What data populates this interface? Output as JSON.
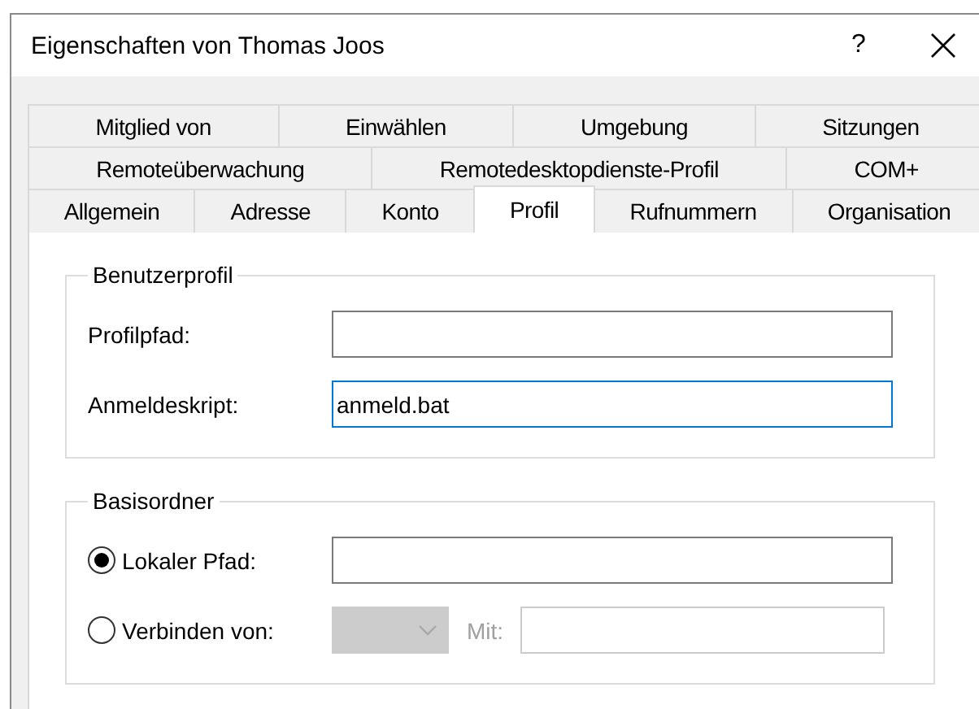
{
  "window": {
    "title": "Eigenschaften von Thomas Joos",
    "help_label": "?"
  },
  "tab_rows": [
    [
      {
        "label": "Mitglied von",
        "selected": false
      },
      {
        "label": "Einwählen",
        "selected": false
      },
      {
        "label": "Umgebung",
        "selected": false
      },
      {
        "label": "Sitzungen",
        "selected": false
      }
    ],
    [
      {
        "label": "Remoteüberwachung",
        "selected": false
      },
      {
        "label": "Remotedesktopdienste-Profil",
        "selected": false
      },
      {
        "label": "COM+",
        "selected": false
      }
    ],
    [
      {
        "label": "Allgemein",
        "selected": false
      },
      {
        "label": "Adresse",
        "selected": false
      },
      {
        "label": "Konto",
        "selected": false
      },
      {
        "label": "Profil",
        "selected": true
      },
      {
        "label": "Rufnummern",
        "selected": false
      },
      {
        "label": "Organisation",
        "selected": false
      }
    ]
  ],
  "user_profile": {
    "title": "Benutzerprofil",
    "fields": [
      {
        "label": "Profilpfad:",
        "focused": false
      },
      {
        "label": "Anmeldeskript:",
        "value": "anmeld.bat",
        "focused": true
      }
    ]
  },
  "home_folder": {
    "title": "Basisordner",
    "local_path": {
      "label": "Lokaler Pfad:",
      "selected": true
    },
    "connect": {
      "label": "Verbinden von:",
      "selected": false,
      "drive_disabled": true,
      "with_label": "Mit:",
      "with_disabled": true
    }
  }
}
